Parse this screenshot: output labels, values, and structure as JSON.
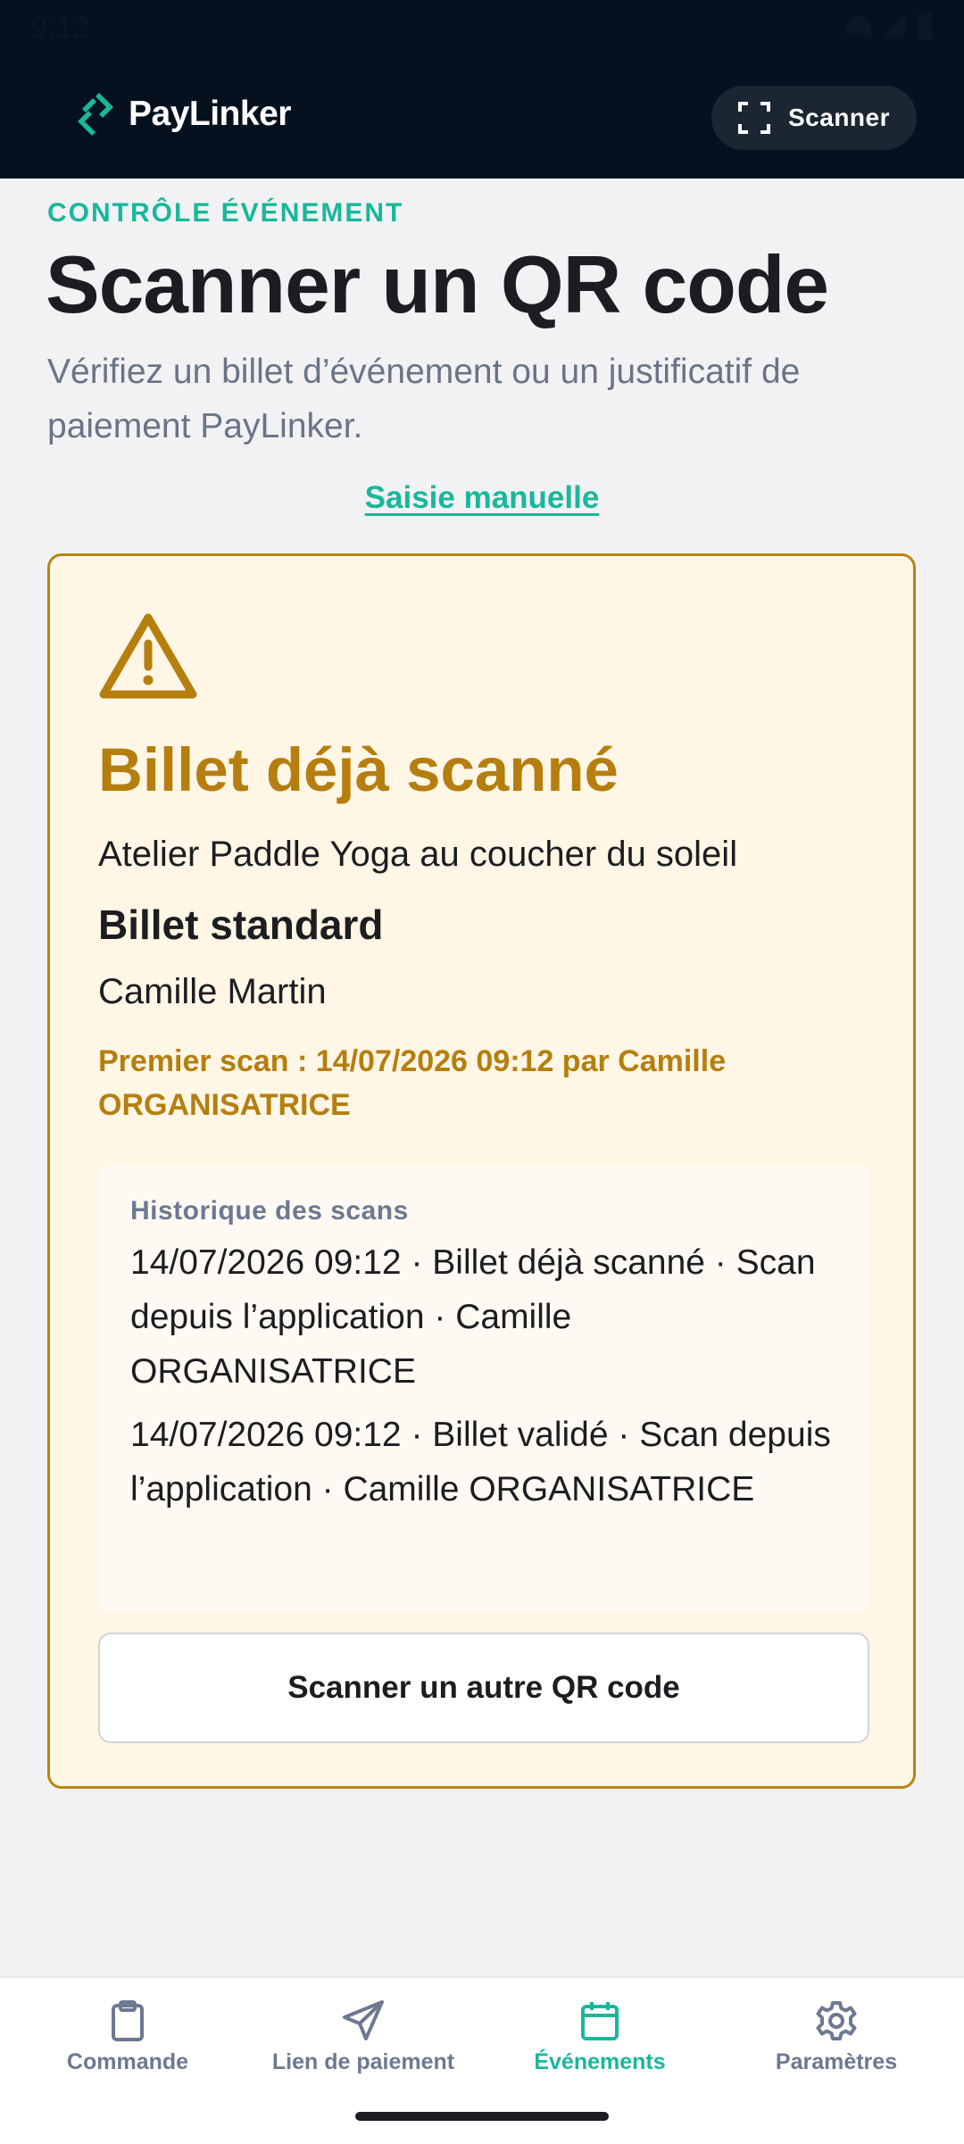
{
  "status_bar": {
    "time": "9:12"
  },
  "header": {
    "brand_name": "PayLinker",
    "scan_button_label": "Scanner",
    "brand_color": "#19b79b",
    "background_color": "#05111f"
  },
  "page": {
    "eyebrow": "CONTRÔLE ÉVÉNEMENT",
    "title": "Scanner un QR code",
    "subtitle": "Vérifiez un billet d’événement ou un justificatif de paiement PayLinker.",
    "manual_link": "Saisie manuelle"
  },
  "result_card": {
    "status_icon": "warning-triangle-icon",
    "status_color": "#b57e0f",
    "title": "Billet déjà scanné",
    "event_name": "Atelier Paddle Yoga au coucher du soleil",
    "ticket_type": "Billet standard",
    "holder_name": "Camille Martin",
    "first_scan": "Premier scan : 14/07/2026 09:12 par Camille ORGANISATRICE",
    "history": {
      "title": "Historique des scans",
      "entries": [
        "14/07/2026 09:12 · Billet déjà scanné · Scan depuis l’application · Camille ORGANISATRICE",
        "14/07/2026 09:12 · Billet validé · Scan depuis l’application · Camille ORGANISATRICE"
      ]
    },
    "rescan_button": "Scanner un autre QR code"
  },
  "bottom_nav": {
    "items": [
      {
        "label": "Commande",
        "icon": "clipboard-icon",
        "active": false
      },
      {
        "label": "Lien de paiement",
        "icon": "send-icon",
        "active": false
      },
      {
        "label": "Événements",
        "icon": "calendar-icon",
        "active": true
      },
      {
        "label": "Paramètres",
        "icon": "gear-icon",
        "active": false
      }
    ]
  }
}
